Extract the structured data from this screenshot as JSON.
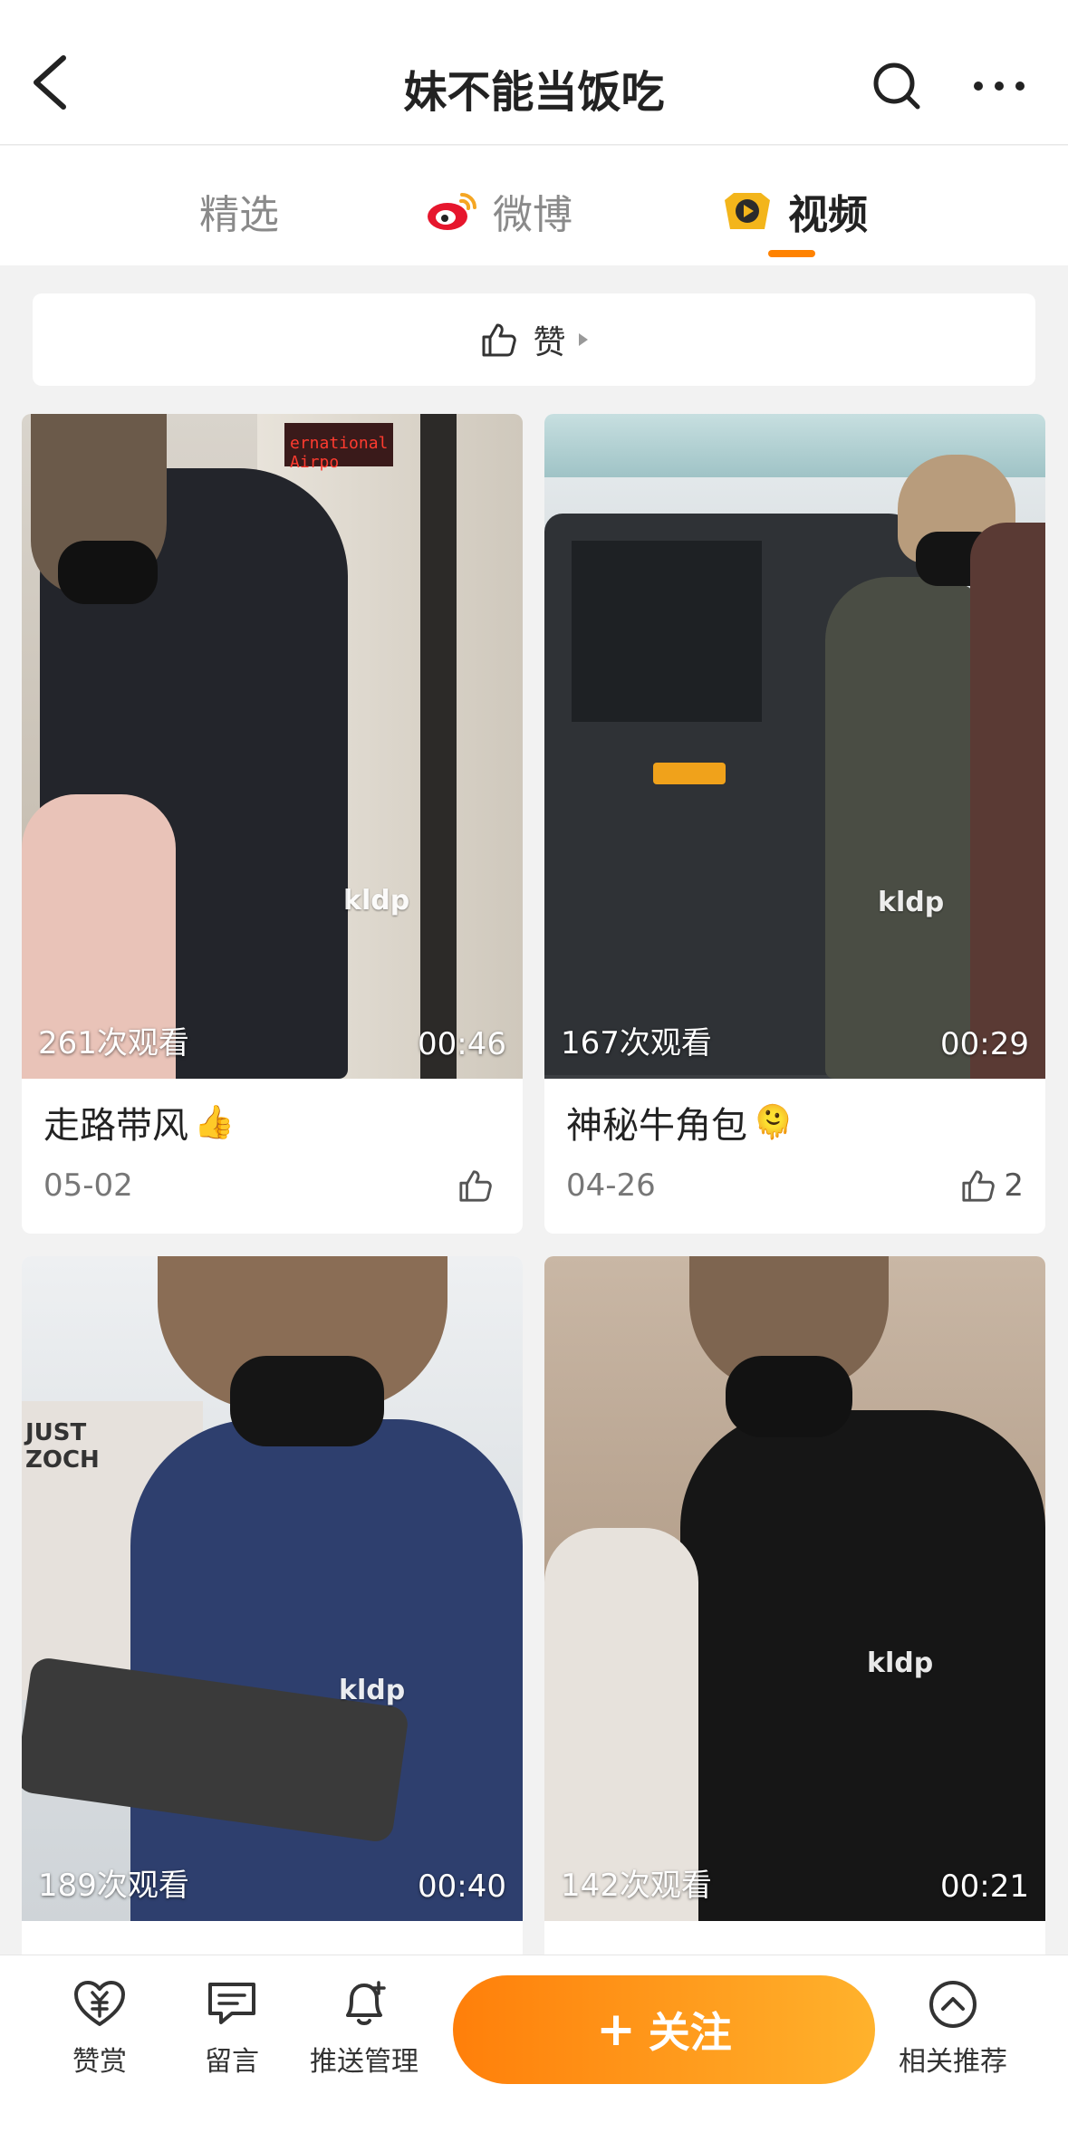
{
  "header": {
    "title": "妹不能当饭吃"
  },
  "tabs": [
    {
      "label": "精选",
      "icon": "none",
      "active": false
    },
    {
      "label": "微博",
      "icon": "weibo-logo-icon",
      "active": false
    },
    {
      "label": "视频",
      "icon": "video-badge-icon",
      "active": true
    }
  ],
  "like_bar": {
    "label": "赞"
  },
  "videos": [
    {
      "title": "走路带风",
      "emoji": "👍",
      "views": "261次观看",
      "duration": "00:46",
      "date": "05-02",
      "likes": "",
      "watermark": "kldp"
    },
    {
      "title": "神秘牛角包",
      "emoji": "🫠",
      "views": "167次观看",
      "duration": "00:29",
      "date": "04-26",
      "likes": "2",
      "watermark": "kldp"
    },
    {
      "title": "",
      "emoji": "",
      "views": "189次观看",
      "duration": "00:40",
      "date": "",
      "likes": "",
      "watermark": "kldp"
    },
    {
      "title": "",
      "emoji": "",
      "views": "142次观看",
      "duration": "00:21",
      "date": "",
      "likes": "",
      "watermark": "kldp"
    }
  ],
  "scene_text": {
    "airport_sign": "ernational Airpo",
    "store_sign": "JUST ZOCH"
  },
  "bottom_bar": {
    "reward": "赞赏",
    "comment": "留言",
    "push": "推送管理",
    "follow": "关注",
    "follow_plus": "+",
    "recommend": "相关推荐"
  },
  "colors": {
    "accent": "#ff8200",
    "follow_gradient_start": "#ff7f0a",
    "follow_gradient_end": "#ffb22c"
  }
}
